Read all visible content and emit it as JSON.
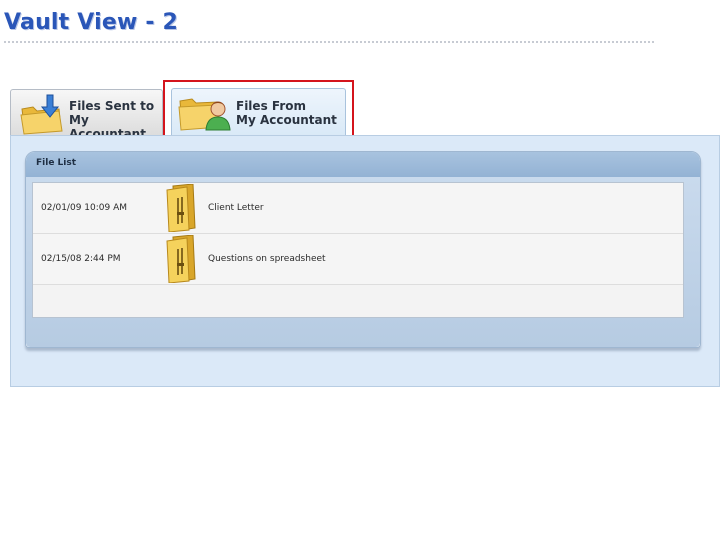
{
  "slide": {
    "title": "Vault View - 2"
  },
  "tabs": [
    {
      "label": "Files Sent to\nMy Accountant",
      "selected": false
    },
    {
      "label": "Files From\nMy Accountant",
      "selected": true
    }
  ],
  "file_list": {
    "title": "File List",
    "rows": [
      {
        "date": "02/01/09 10:09 AM",
        "icon": "folder-icon",
        "name": "Client Letter"
      },
      {
        "date": "02/15/08 2:44 PM",
        "icon": "folder-icon",
        "name": "Questions on spreadsheet"
      }
    ]
  },
  "colors": {
    "title": "#2a56b8",
    "highlight": "#d4141c",
    "panel": "#dbe9f8",
    "header": "#93b2d4"
  }
}
